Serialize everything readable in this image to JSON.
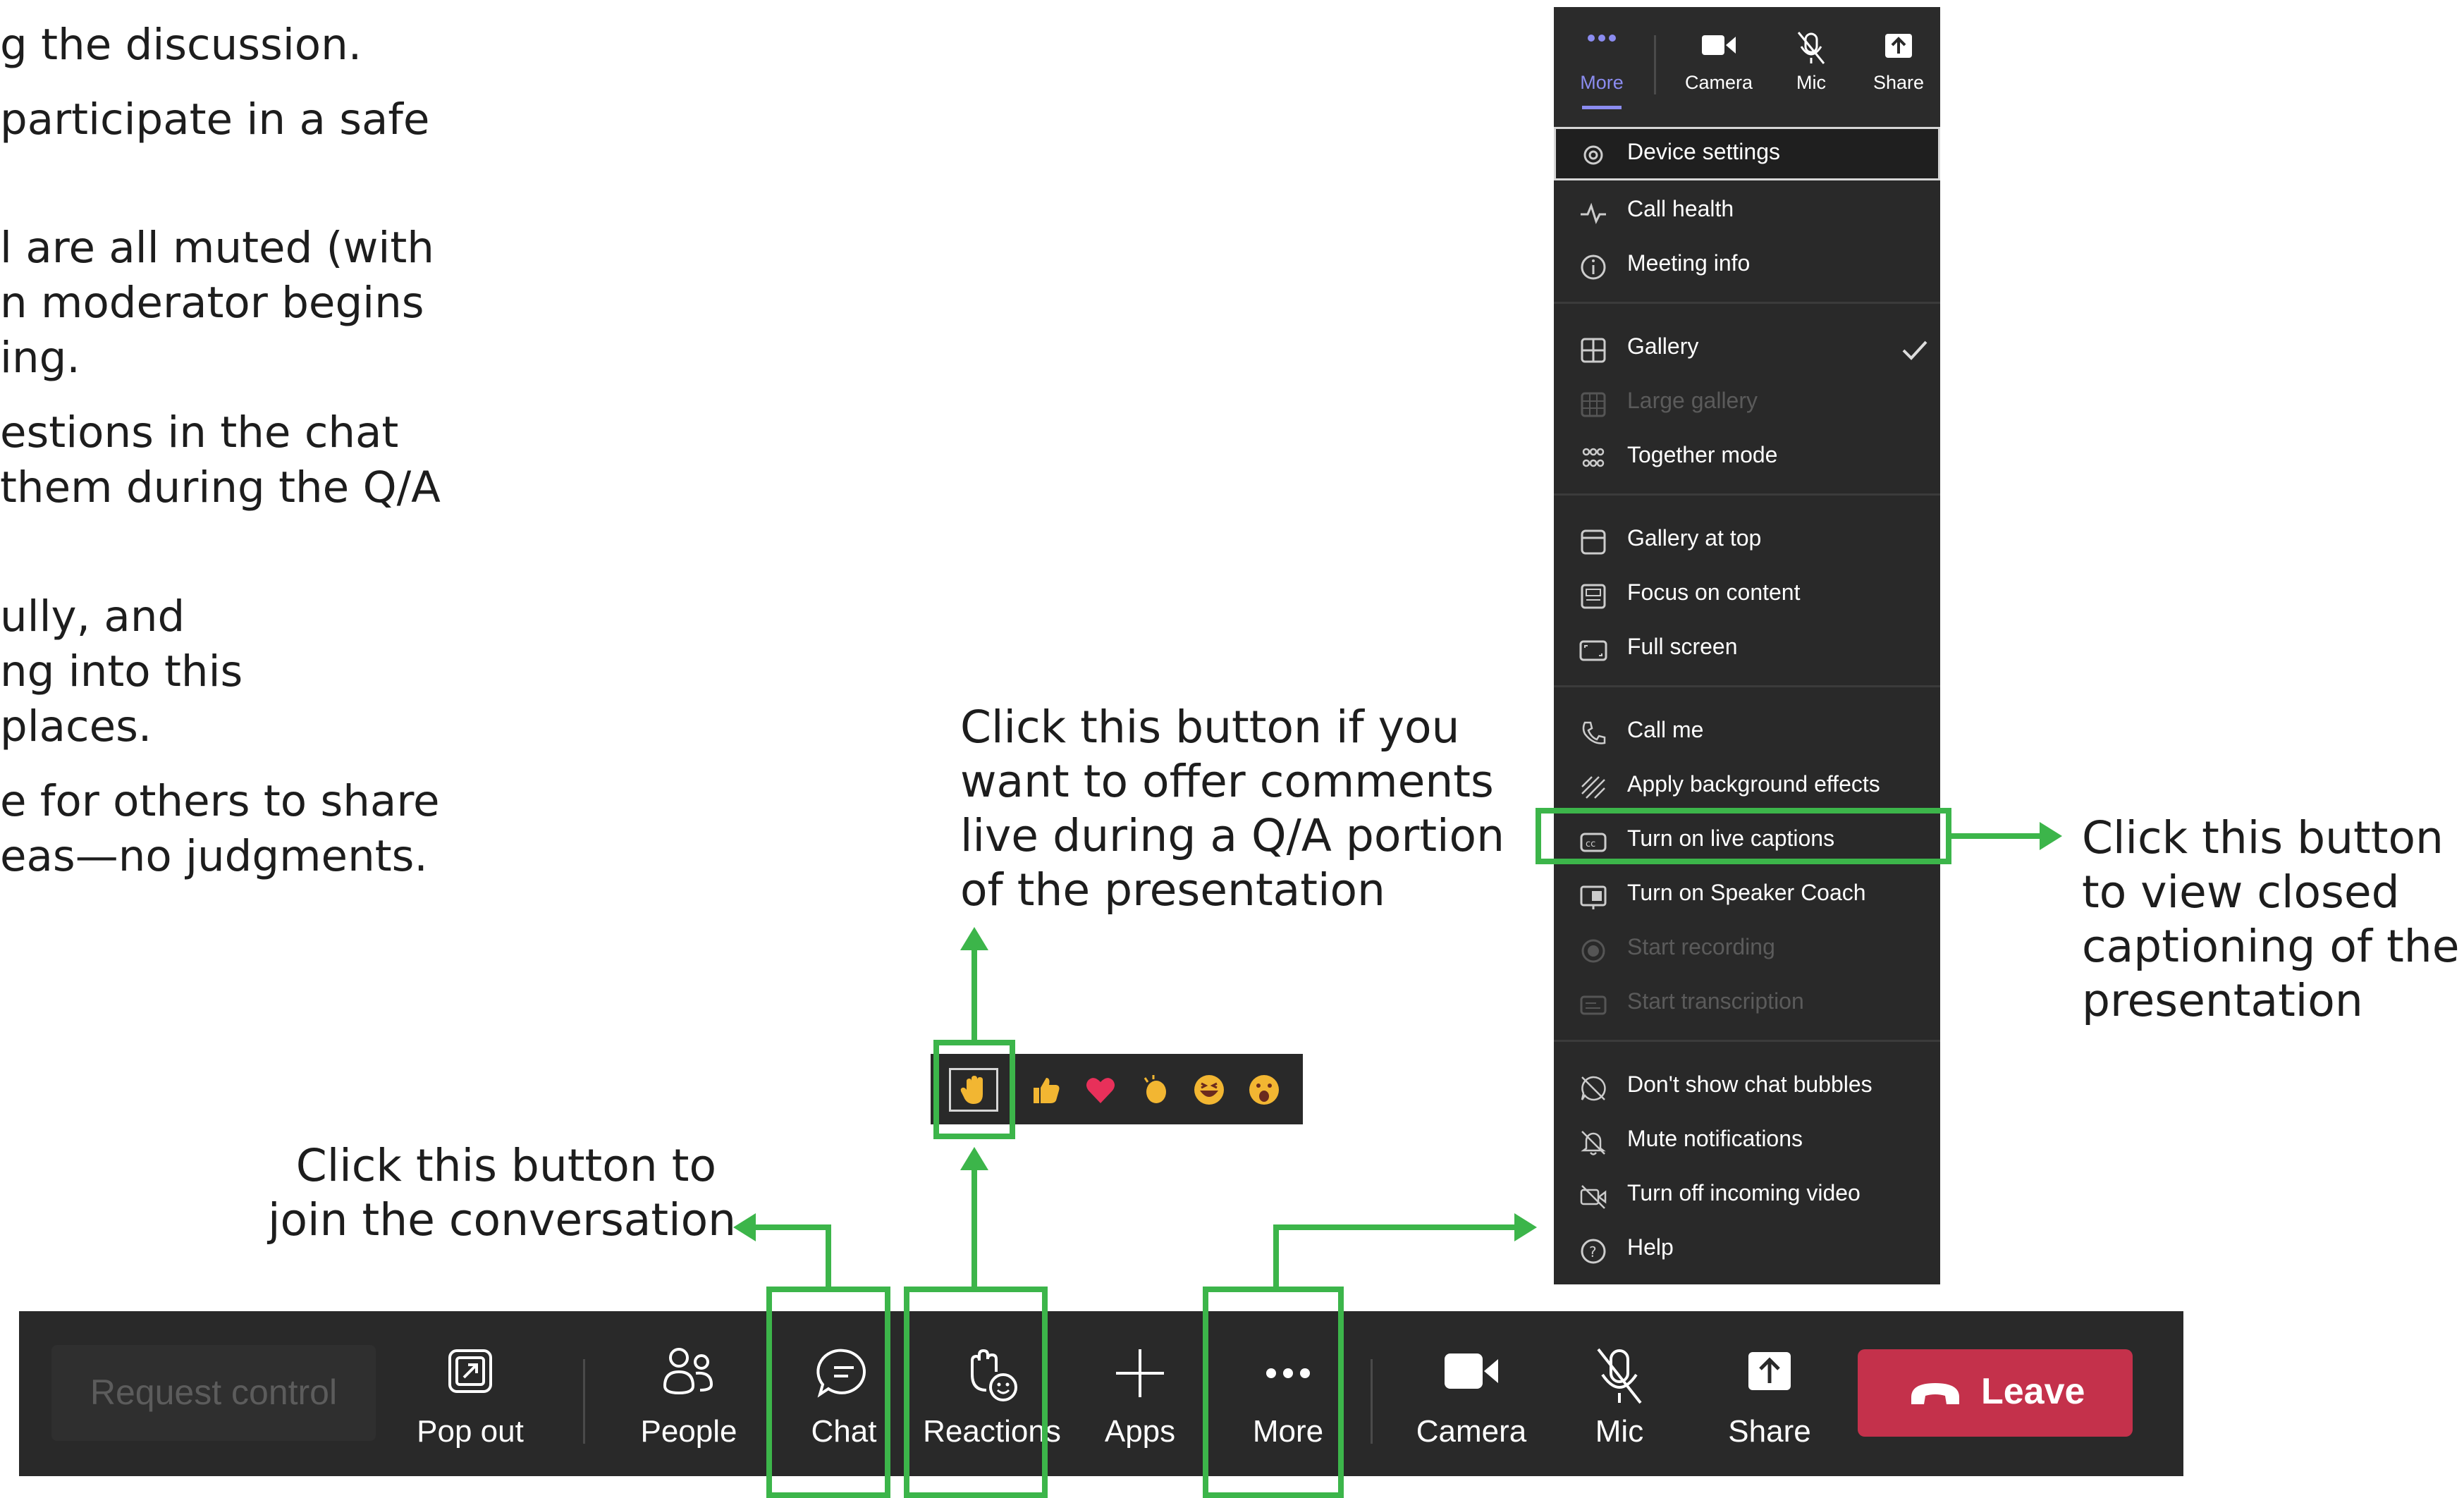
{
  "left_text": [
    "g the discussion.",
    "participate in a safe",
    "l are all muted (with",
    "n moderator begins",
    "ing.",
    "estions in the chat",
    " them during the Q/A",
    "ully, and",
    "ng into this",
    "places.",
    "e for others to share",
    "eas—no judgments."
  ],
  "annotations": {
    "reactions": [
      "Click this button if you",
      "want to offer comments",
      "live during a Q/A portion",
      "of the presentation"
    ],
    "captions": [
      "Click this button",
      "to view closed",
      "captioning of the",
      "presentation"
    ],
    "chat": [
      "Click this button to",
      "join the conversation"
    ]
  },
  "colors": {
    "highlight": "#3cb54a",
    "toolbar_bg": "#292929",
    "leave_bg": "#c4314b",
    "accent_more": "#8b8cf0"
  },
  "toolbar": {
    "request_control": "Request control",
    "popout": "Pop out",
    "people": "People",
    "chat": "Chat",
    "reactions": "Reactions",
    "apps": "Apps",
    "more": "More",
    "camera": "Camera",
    "mic": "Mic",
    "share": "Share",
    "leave": "Leave"
  },
  "menu_top": {
    "more": "More",
    "camera": "Camera",
    "mic": "Mic",
    "share": "Share"
  },
  "menu": {
    "device_settings": "Device settings",
    "call_health": "Call health",
    "meeting_info": "Meeting info",
    "gallery": "Gallery",
    "large_gallery": "Large gallery",
    "together_mode": "Together mode",
    "gallery_at_top": "Gallery at top",
    "focus_on_content": "Focus on content",
    "full_screen": "Full screen",
    "call_me": "Call me",
    "apply_background": "Apply background effects",
    "live_captions": "Turn on live captions",
    "speaker_coach": "Turn on Speaker Coach",
    "start_recording": "Start recording",
    "start_transcription": "Start transcription",
    "chat_bubbles": "Don't show chat bubbles",
    "mute_notifications": "Mute notifications",
    "incoming_video": "Turn off incoming video",
    "help": "Help"
  },
  "reactions_bar": [
    "raised-hand",
    "thumbs-up",
    "heart",
    "clapping",
    "laughing",
    "surprised"
  ]
}
